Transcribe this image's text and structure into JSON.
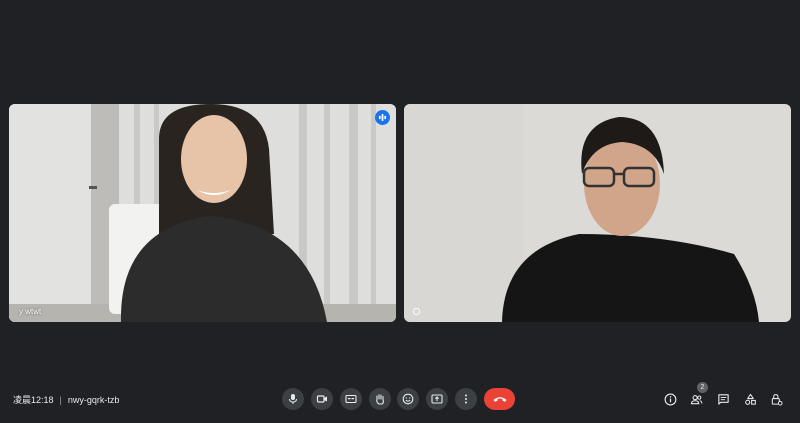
{
  "participants": [
    {
      "name": "y wtwt",
      "speaking": true
    },
    {
      "name": "",
      "speaking": false
    }
  ],
  "meeting": {
    "time": "凌晨12:18",
    "code": "nwy-gqrk-tzb"
  },
  "controls": {
    "participant_count": "2"
  },
  "colors": {
    "background": "#202124",
    "control_bg": "#3c4043",
    "end_call": "#ea4335",
    "active_border": "#8ab4f8",
    "speaking_badge": "#1a73e8"
  },
  "icons": [
    "microphone-icon",
    "camera-icon",
    "captions-icon",
    "raise-hand-icon",
    "emoji-icon",
    "present-icon",
    "more-options-icon",
    "end-call-icon",
    "info-icon",
    "people-icon",
    "chat-icon",
    "activities-icon",
    "host-controls-icon"
  ]
}
